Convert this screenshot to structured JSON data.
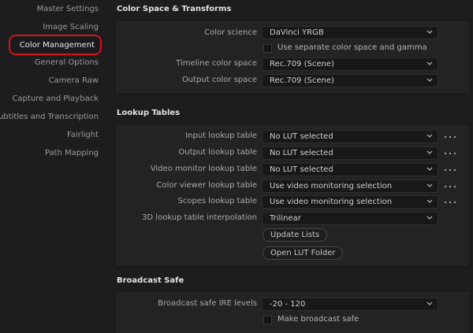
{
  "sidebar": {
    "items": [
      {
        "label": "Master Settings"
      },
      {
        "label": "Image Scaling"
      },
      {
        "label": "Color Management"
      },
      {
        "label": "General Options"
      },
      {
        "label": "Camera Raw"
      },
      {
        "label": "Capture and Playback"
      },
      {
        "label": "Subtitles and Transcription"
      },
      {
        "label": "Fairlight"
      },
      {
        "label": "Path Mapping"
      }
    ],
    "active": "Color Management"
  },
  "color_space": {
    "title": "Color Space & Transforms",
    "color_science_label": "Color science",
    "color_science_value": "DaVinci YRGB",
    "separate_checkbox_label": "Use separate color space and gamma",
    "timeline_label": "Timeline color space",
    "timeline_value": "Rec.709 (Scene)",
    "output_label": "Output color space",
    "output_value": "Rec.709 (Scene)"
  },
  "lookup_tables": {
    "title": "Lookup Tables",
    "input_label": "Input lookup table",
    "input_value": "No LUT selected",
    "output_label": "Output lookup table",
    "output_value": "No LUT selected",
    "video_monitor_label": "Video monitor lookup table",
    "video_monitor_value": "No LUT selected",
    "color_viewer_label": "Color viewer lookup table",
    "color_viewer_value": "Use video monitoring selection",
    "scopes_label": "Scopes lookup table",
    "scopes_value": "Use video monitoring selection",
    "interp_label": "3D lookup table interpolation",
    "interp_value": "Trilinear",
    "update_button": "Update Lists",
    "open_folder_button": "Open LUT Folder"
  },
  "broadcast_safe": {
    "title": "Broadcast Safe",
    "ire_label": "Broadcast safe IRE levels",
    "ire_value": "-20 - 120",
    "make_safe_label": "Make broadcast safe"
  },
  "colors": {
    "background": "#1d1d20",
    "panel": "#232326",
    "highlight_ring": "#d8101a"
  }
}
